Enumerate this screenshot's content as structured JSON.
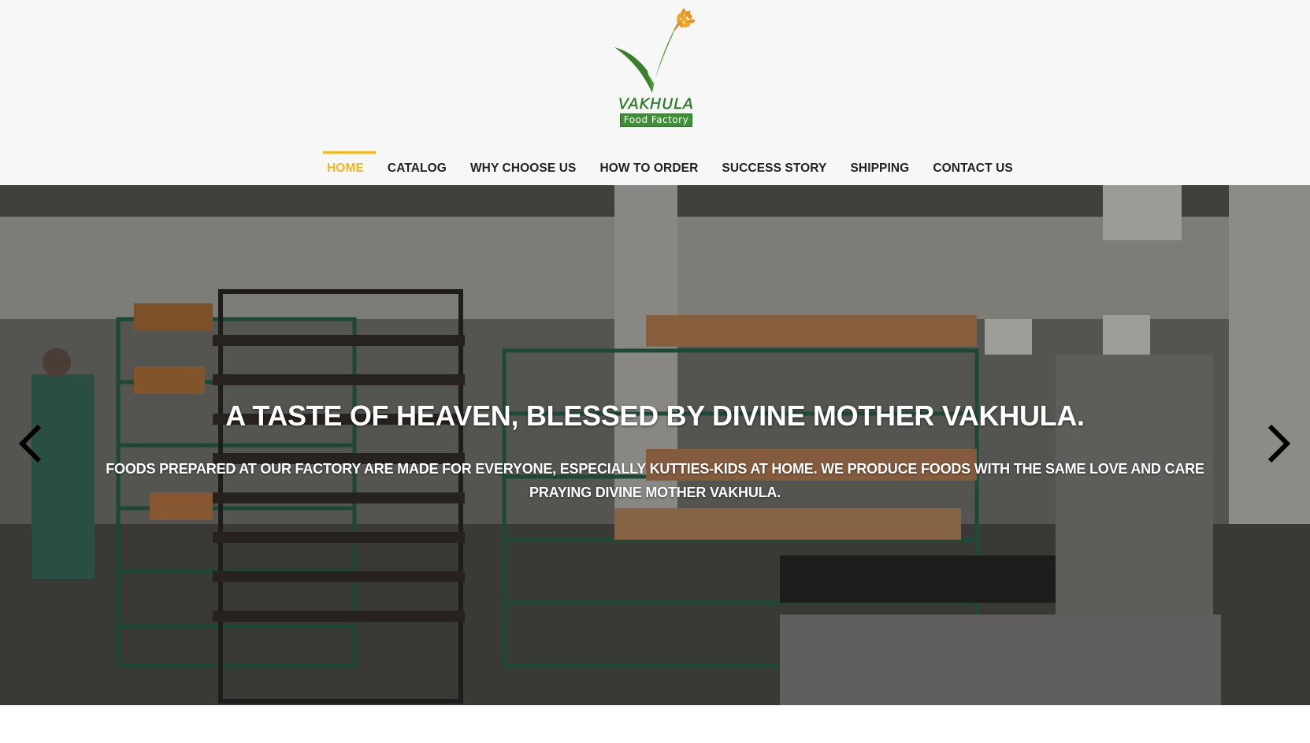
{
  "header": {
    "logo": {
      "name": "VAKHULA",
      "subtitle": "Food Factory",
      "icon": "wheat-checkmark-logo"
    },
    "nav": [
      {
        "label": "HOME",
        "active": true
      },
      {
        "label": "CATALOG",
        "active": false
      },
      {
        "label": "WHY CHOOSE US",
        "active": false
      },
      {
        "label": "HOW TO ORDER",
        "active": false
      },
      {
        "label": "SUCCESS STORY",
        "active": false
      },
      {
        "label": "SHIPPING",
        "active": false
      },
      {
        "label": "CONTACT US",
        "active": false
      }
    ]
  },
  "hero": {
    "title": "A TASTE OF HEAVEN, BLESSED BY DIVINE MOTHER VAKHULA.",
    "text": "FOODS PREPARED AT OUR FACTORY ARE MADE FOR EVERYONE, ESPECIALLY KUTTIES-KIDS AT HOME. WE PRODUCE FOODS WITH THE SAME LOVE AND CARE PRAYING DIVINE MOTHER VAKHULA.",
    "prev_icon": "chevron-left-icon",
    "next_icon": "chevron-right-icon"
  },
  "colors": {
    "accent": "#f3b61f",
    "brand_green": "#3f8f36",
    "header_bg": "#f7f7f7",
    "nav_text": "#222222"
  }
}
